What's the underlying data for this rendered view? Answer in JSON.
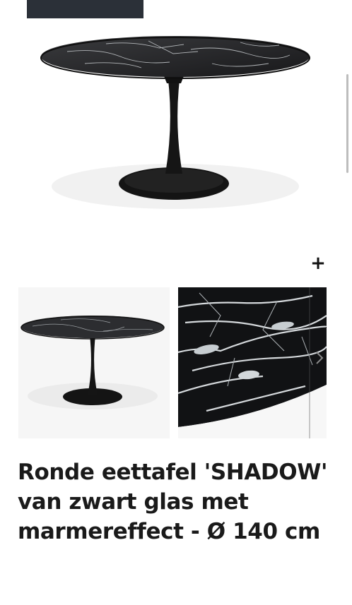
{
  "product": {
    "title": "Ronde eettafel 'SHADOW' van zwart glas met marmereffect - Ø 140 cm"
  },
  "gallery": {
    "expand_label": "+",
    "next_icon": "chevron-right-icon"
  },
  "colors": {
    "marble": "#1f1f21",
    "vein": "#cfd3d6",
    "title": "#1a1a1a"
  }
}
